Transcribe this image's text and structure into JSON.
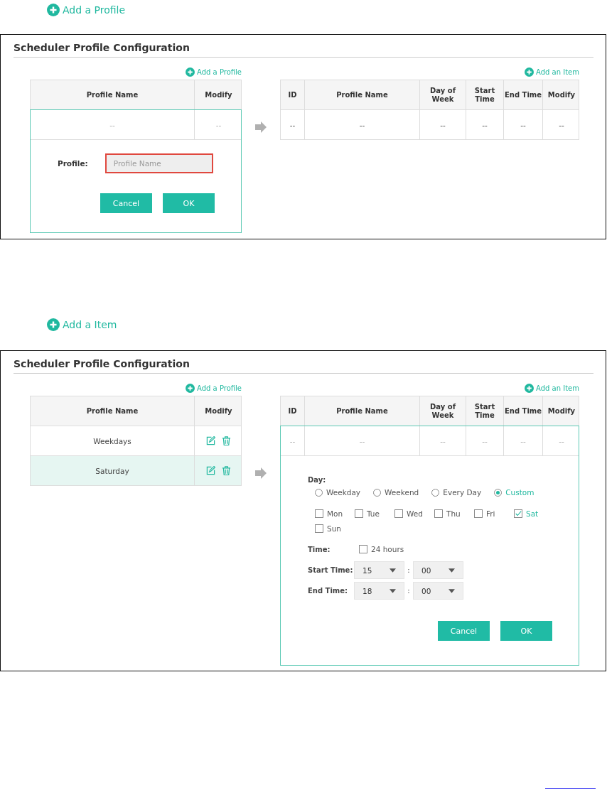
{
  "sections": [
    {
      "top_link": "Add a Profile",
      "panel": {
        "title": "Scheduler Profile Configuration",
        "profile_link": "Add a Profile",
        "item_link": "Add an Item",
        "profile_table": {
          "columns": [
            "Profile Name",
            "Modify"
          ],
          "rows": [
            {
              "kind": "placeholder",
              "name": "--",
              "modify": "--",
              "selected": false
            }
          ],
          "editor": {
            "label": "Profile:",
            "placeholder": "Profile Name",
            "invalid": true,
            "buttons": [
              "Cancel",
              "OK"
            ]
          }
        },
        "item_table": {
          "columns": [
            "ID",
            "Profile Name",
            "Day of Week",
            "Start Time",
            "End Time",
            "Modify"
          ],
          "rows": [
            {
              "cells": [
                "--",
                "--",
                "--",
                "--",
                "--",
                "--"
              ]
            }
          ]
        }
      }
    },
    {
      "top_link": "Add a Item",
      "panel": {
        "title": "Scheduler Profile Configuration",
        "profile_link": "Add a Profile",
        "item_link": "Add an Item",
        "profile_table": {
          "columns": [
            "Profile Name",
            "Modify"
          ],
          "rows": [
            {
              "kind": "profile",
              "name": "Weekdays",
              "selected": false
            },
            {
              "kind": "profile",
              "name": "Saturday",
              "selected": true
            }
          ]
        },
        "item_table": {
          "columns": [
            "ID",
            "Profile Name",
            "Day of Week",
            "Start Time",
            "End Time",
            "Modify"
          ],
          "rows": [
            {
              "cells": [
                "--",
                "--",
                "--",
                "--",
                "--",
                "--"
              ]
            }
          ],
          "editor": {
            "day_label": "Day:",
            "day_options": [
              {
                "label": "Weekday",
                "selected": false
              },
              {
                "label": "Weekend",
                "selected": false
              },
              {
                "label": "Every Day",
                "selected": false
              },
              {
                "label": "Custom",
                "selected": true
              }
            ],
            "days": [
              {
                "label": "Mon",
                "checked": false
              },
              {
                "label": "Tue",
                "checked": false
              },
              {
                "label": "Wed",
                "checked": false
              },
              {
                "label": "Thu",
                "checked": false
              },
              {
                "label": "Fri",
                "checked": false
              },
              {
                "label": "Sat",
                "checked": true
              },
              {
                "label": "Sun",
                "checked": false
              }
            ],
            "time_label": "Time:",
            "all_day": {
              "label": "24 hours",
              "checked": false
            },
            "times": [
              {
                "label": "Start Time:",
                "hour": "15",
                "separator": ":",
                "minute": "00"
              },
              {
                "label": "End Time:",
                "hour": "18",
                "separator": ":",
                "minute": "00"
              }
            ],
            "buttons": [
              "Cancel",
              "OK"
            ]
          }
        }
      }
    }
  ]
}
